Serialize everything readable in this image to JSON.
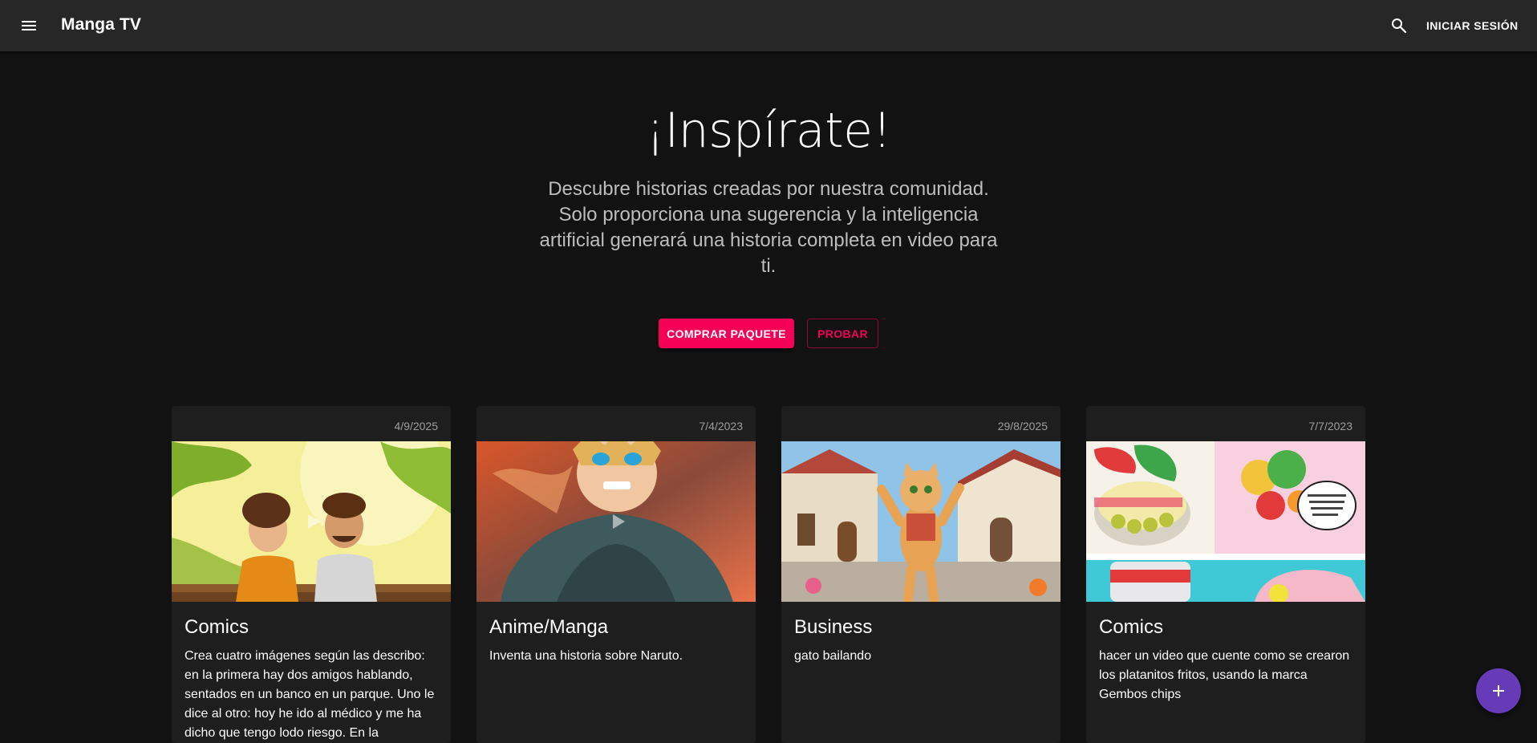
{
  "appbar": {
    "title": "Manga TV",
    "login_label": "INICIAR SESIÓN"
  },
  "hero": {
    "title": "¡Inspírate!",
    "subtitle": "Descubre historias creadas por nuestra comunidad. Solo proporciona una sugerencia y la inteligencia artificial generará una historia completa en video para ti.",
    "buy_label": "COMPRAR PAQUETE",
    "try_label": "PROBAR"
  },
  "cards": [
    {
      "date": "4/9/2025",
      "title": "Comics",
      "description": "Crea cuatro imágenes según las describo: en la primera hay dos amigos hablando, sentados en un banco en un parque. Uno le dice al otro: hoy he ido al médico y me ha dicho que tengo lodo riesgo. En la"
    },
    {
      "date": "7/4/2023",
      "title": "Anime/Manga",
      "description": "Inventa una historia sobre Naruto."
    },
    {
      "date": "29/8/2025",
      "title": "Business",
      "description": "gato bailando"
    },
    {
      "date": "7/7/2023",
      "title": "Comics",
      "description": "hacer un video que cuente como se crearon los platanitos fritos, usando la marca Gembos chips"
    }
  ],
  "colors": {
    "accent": "#f50057",
    "fab": "#673ab7",
    "appbar": "#272727",
    "background": "#121212",
    "card": "#1e1e1e"
  },
  "icons": {
    "menu": "menu-icon",
    "search": "search-icon",
    "play": "play-icon",
    "add": "plus-icon"
  }
}
